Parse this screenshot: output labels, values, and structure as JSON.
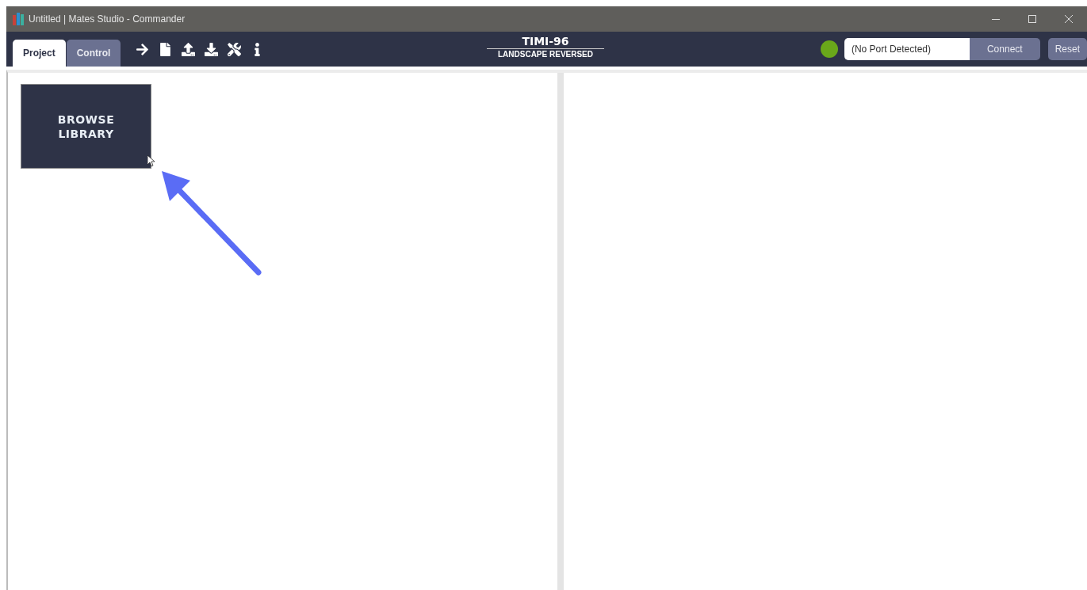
{
  "window": {
    "title": "Untitled | Mates Studio - Commander"
  },
  "tabs": [
    {
      "label": "Project",
      "selected": true
    },
    {
      "label": "Control",
      "selected": false
    }
  ],
  "device": {
    "name": "TIMI-96",
    "orientation": "LANDSCAPE REVERSED"
  },
  "port": {
    "value": "(No Port Detected)"
  },
  "buttons": [
    "Connect",
    "Reset"
  ],
  "library_tile": {
    "label": "BROWSE LIBRARY"
  }
}
